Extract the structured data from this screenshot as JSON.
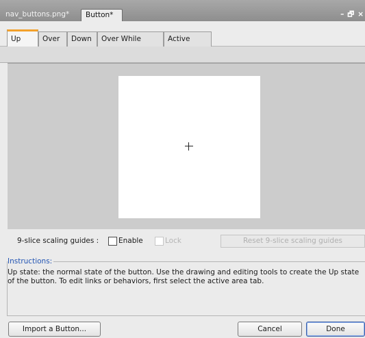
{
  "titlebar": {
    "tabs": [
      {
        "label": "nav_buttons.png*"
      },
      {
        "label": "Button*"
      }
    ],
    "controls": {
      "minimize": "–",
      "restore": "🗗",
      "close": "×"
    }
  },
  "state_tabs": [
    {
      "label": "Up"
    },
    {
      "label": "Over"
    },
    {
      "label": "Down"
    },
    {
      "label": "Over While Down"
    },
    {
      "label": "Active Area"
    }
  ],
  "slice": {
    "label": "9-slice scaling guides :",
    "enable_label": "Enable",
    "lock_label": "Lock",
    "reset_label": "Reset 9-slice scaling guides"
  },
  "instructions": {
    "title": "Instructions:",
    "text": "Up state: the normal state of the button. Use the drawing and editing tools to create the Up state of the button. To edit links or behaviors, first select the active area tab."
  },
  "buttons": {
    "import": "Import a Button...",
    "cancel": "Cancel",
    "done": "Done"
  },
  "colors": {
    "selected_tab_accent": "#f3a12a",
    "instructions_title": "#2254b3"
  }
}
